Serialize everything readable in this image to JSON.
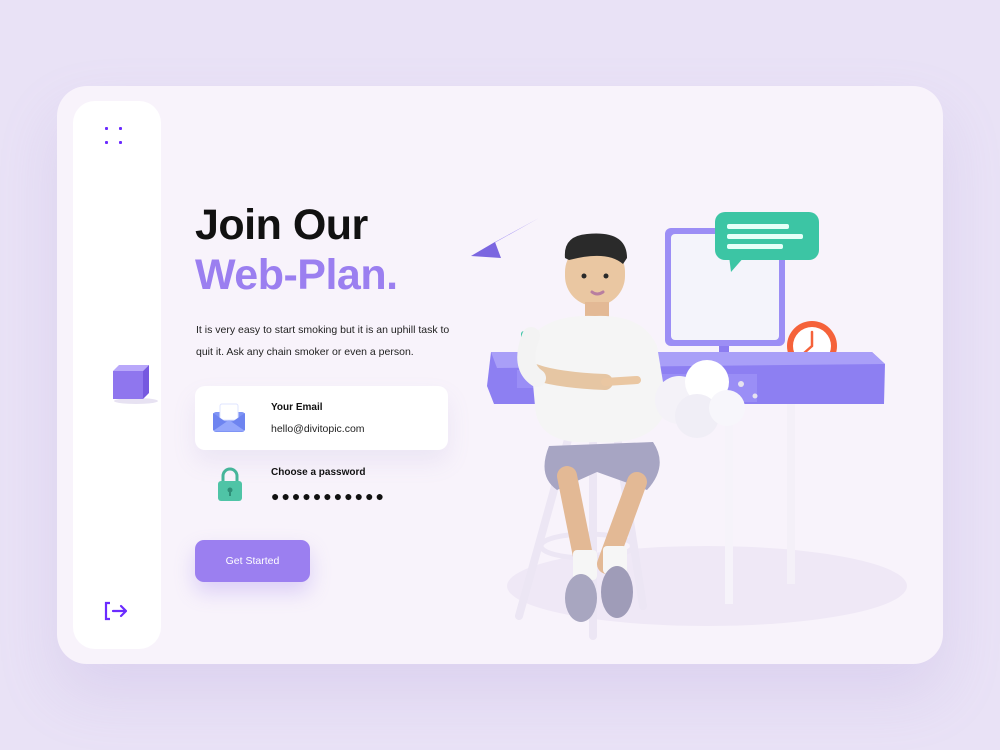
{
  "hero": {
    "title_line1": "Join Our",
    "title_line2": "Web-Plan.",
    "description": "It is very easy to start smoking but it is an uphill task to quit it. Ask any chain smoker or even a person."
  },
  "form": {
    "email": {
      "label": "Your Email",
      "value": "hello@divitopic.com"
    },
    "password": {
      "label": "Choose a password",
      "value": "●●●●●●●●●●●"
    },
    "submit_label": "Get Started"
  },
  "sidebar": {
    "icons": [
      "menu-dots-icon",
      "cube-icon",
      "logout-icon"
    ]
  },
  "colors": {
    "background": "#e9e2f6",
    "card": "#f8f3fb",
    "accent": "#9b7ff0",
    "icon_accent": "#6b2bff"
  }
}
